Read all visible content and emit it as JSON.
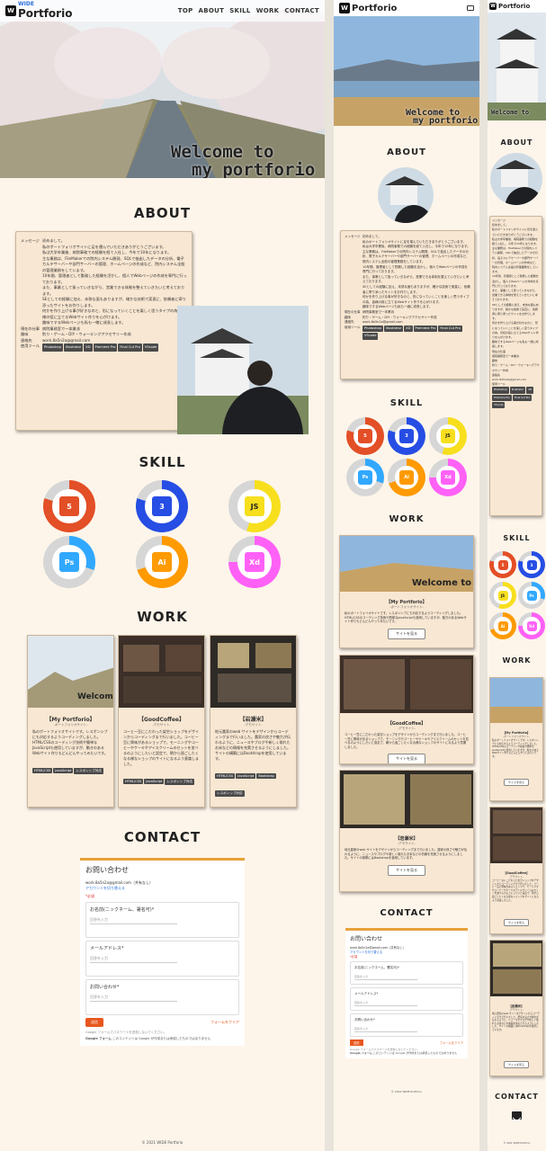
{
  "brand": {
    "name": "Portforio",
    "prefix": "WIDE",
    "mark": "W"
  },
  "nav": [
    "TOP",
    "ABOUT",
    "SKILL",
    "WORK",
    "CONTACT"
  ],
  "hero": {
    "line1": "Welcome to",
    "line2": "my portforio"
  },
  "sections": {
    "about": "ABOUT",
    "skill": "SKILL",
    "work": "WORK",
    "contact": "CONTACT"
  },
  "about": {
    "message_label": "メッセージ",
    "message_lines": [
      "初めまして。",
      "私のポートフォリオサイトに足を運んでいただきありがとうございます。",
      "私は大学卒業後、病院事務での経験を経て入社し、今年で10年になります。",
      "主な業務は、FileMakerでの院内システム開発、SQLで抽出したデータの分析、電子カルテサーバーや部門サーバーの管理、ホームページの作成など、院内システム全般の管理業務をしています。",
      "10年間、管理者として勤務した経験を活かし、個人でWebページの作成を専門に行っております。",
      "また、事業として扱っていきながら、営業できる体制を整えていきたいと考えております。",
      "SEとしての経験に加え、未熟な面もありますが、確かな技術で実直に、依頼者に寄り添ったサイトをお作りします。",
      "何かを作り上げる事が好きなのと、形になっていくことを楽しく思うタイプの為、皆様の役に立てるWebサイト作りを心がけます。",
      "趣味でするWebページも私も一緒に成長します。"
    ],
    "job_label": "現在の仕事",
    "job": "病院事務室で一本業派",
    "hobby_label": "趣味",
    "hobby": "釣り・ゲーム・DIY・ウォーキングアクセサリー作成",
    "contact_label": "連絡先",
    "contact": "work.8a5n2a@gmail.com",
    "tools_label": "使用ツール",
    "tools": [
      "Photoshop",
      "Illustrator",
      "XD",
      "Premiere Pro",
      "Final Cut Pro",
      "VScode"
    ]
  },
  "skills": [
    {
      "name": "html5-icon",
      "label": "5",
      "color": "#e34f26",
      "pct": 0.8
    },
    {
      "name": "css3-icon",
      "label": "3",
      "color": "#264de4",
      "pct": 0.8
    },
    {
      "name": "js-icon",
      "label": "JS",
      "color": "#f7df1e",
      "pct": 0.55
    },
    {
      "name": "photoshop-icon",
      "label": "Ps",
      "color": "#31a8ff",
      "pct": 0.3
    },
    {
      "name": "illustrator-icon",
      "label": "Ai",
      "color": "#ff9a00",
      "pct": 0.7
    },
    {
      "name": "xd-icon",
      "label": "Xd",
      "color": "#ff61f6",
      "pct": 0.75
    }
  ],
  "works": [
    {
      "title": "【My Portforio】",
      "sub": "-ポートフォリオサイト-",
      "desc": "私のポートフォリオサイトです。レスポンシブにも対応するようコーディングしました。HTML/CSSのコーディング技術や簡単なJavaScriptも使用していますが、動きのあるWebサイト作りもどんどんやってみたいです。",
      "tags": [
        "HTML/CSS",
        "JavaScript",
        "レスポンシブ対応"
      ],
      "button": "サイトを見る"
    },
    {
      "title": "【GoodCoffee】",
      "sub": "-デモサイト-",
      "desc": "コーヒー豆にこだわった架空ショップをデザインからコーディングまで行いました。コーヒー豆に興味があるショップで、モーニングやコーヒーやケーキやアイスクリームのセットを並べるのようにしたいと設定で、朝から過ごしたくなる様なショップのサイトになるよう意識しました。",
      "tags": [
        "HTML/CSS",
        "JavaScript",
        "レスポンシブ対応"
      ],
      "button": "サイトを見る"
    },
    {
      "title": "【岩瀬米】",
      "sub": "-デモサイト-",
      "desc": "地元農家のweb サイトをデザインからコーディングまで行いました。農家の良さや魅力が伝わるように、ニュースやブログや新しく取れたお米などの情報を充実させるようにしました。サイトの構築にはBootstrapを使用しています。",
      "tags": [
        "HTML/CSS",
        "JavaScript",
        "Bootstrap",
        "レスポンシブ対応"
      ],
      "button": "サイトを見る"
    }
  ],
  "form": {
    "title": "お問い合わせ",
    "account": "work.8a5n2a@gmail.com（共有なし）",
    "switch": "アカウントを切り替える",
    "required": "*必須",
    "fields": [
      {
        "label": "お名前(ニックネーム、署名可)*",
        "placeholder": "回答を入力"
      },
      {
        "label": "メールアドレス*",
        "placeholder": "回答を入力"
      },
      {
        "label": "お問い合わせ*",
        "placeholder": "回答を入力"
      }
    ],
    "submit": "送信",
    "clear": "フォームをクリア",
    "note": "Google フォームでパスワードを送信しないでください。",
    "brand": "Google フォーム",
    "brand_note": "このコンテンツは Google が作成または承認したものではありません"
  },
  "footer": "© 2021 WIDE Portforio",
  "colors": {
    "bg": "#fdf5ea",
    "card": "#f8e7d2",
    "accent": "#e8a13a",
    "link": "#2a6fdb"
  }
}
